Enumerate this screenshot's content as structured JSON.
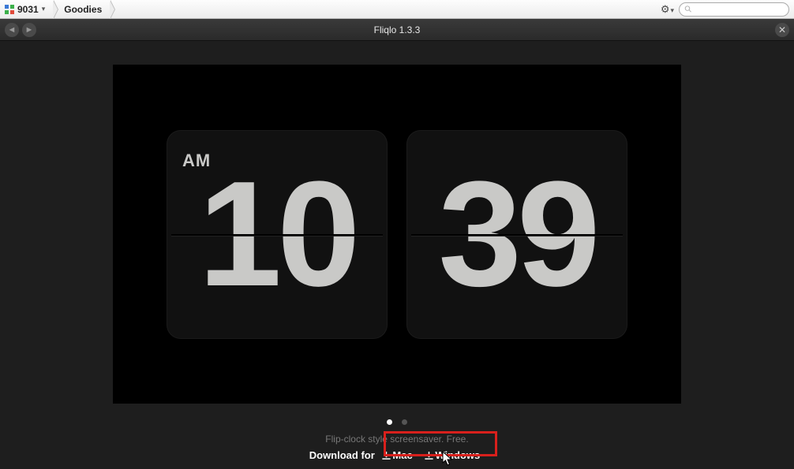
{
  "toolbar": {
    "site_label": "9031",
    "crumb": "Goodies",
    "search_placeholder": ""
  },
  "viewer": {
    "title": "Fliqlo 1.3.3"
  },
  "clock": {
    "ampm": "AM",
    "hours": "10",
    "minutes": "39"
  },
  "description": "Flip-clock style screensaver.   Free.",
  "download": {
    "prefix": "Download for",
    "mac": "Mac",
    "windows": "Windows"
  }
}
